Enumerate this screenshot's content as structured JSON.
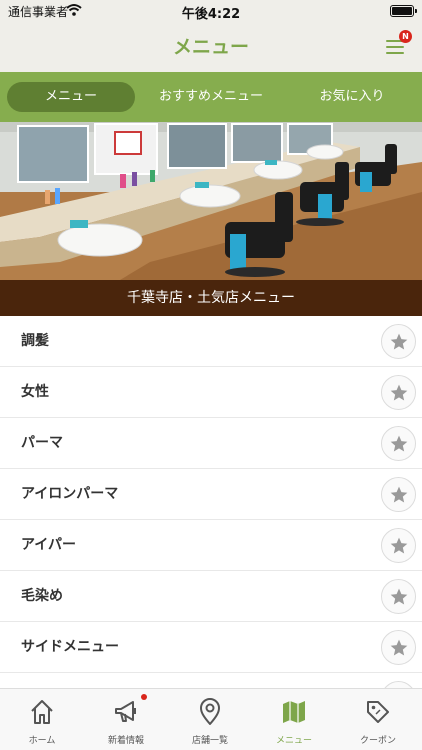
{
  "status_bar": {
    "carrier": "通信事業者",
    "time": "午後4:22"
  },
  "header": {
    "title": "メニュー",
    "badge": "N"
  },
  "tabs": [
    {
      "label": "メニュー",
      "active": true
    },
    {
      "label": "おすすめメニュー",
      "active": false
    },
    {
      "label": "お気に入り",
      "active": false
    }
  ],
  "hero": {
    "caption": "千葉寺店・土気店メニュー"
  },
  "menu_items": [
    {
      "label": "調髪"
    },
    {
      "label": "女性"
    },
    {
      "label": "パーマ"
    },
    {
      "label": "アイロンパーマ"
    },
    {
      "label": "アイパー"
    },
    {
      "label": "毛染め"
    },
    {
      "label": "サイドメニュー"
    }
  ],
  "bottom_nav": [
    {
      "label": "ホーム",
      "icon": "home-icon"
    },
    {
      "label": "新着情報",
      "icon": "megaphone-icon",
      "has_notification": true
    },
    {
      "label": "店舗一覧",
      "icon": "map-pin-icon"
    },
    {
      "label": "メニュー",
      "icon": "map-icon",
      "active": true
    },
    {
      "label": "クーポン",
      "icon": "coupon-tag-icon"
    }
  ],
  "colors": {
    "accent_green": "#7ea64a",
    "tab_strip_green": "#86ad4e",
    "active_tab_green": "#5f7f32",
    "caption_brown": "#4a250c",
    "notification_red": "#d9261c"
  }
}
